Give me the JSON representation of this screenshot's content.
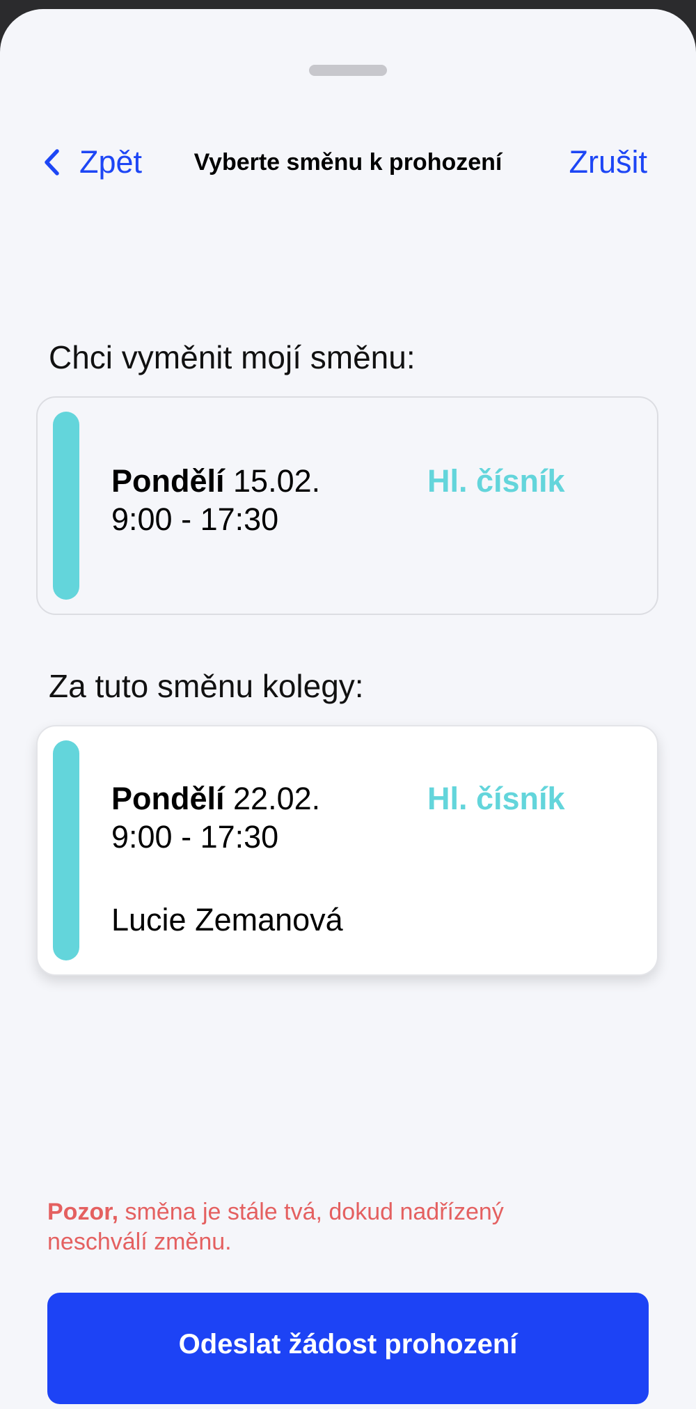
{
  "nav": {
    "back_label": "Zpět",
    "title": "Vyberte směnu k prohození",
    "cancel_label": "Zrušit"
  },
  "my_shift": {
    "section_label": "Chci vyměnit mojí směnu:",
    "day": "Pondělí",
    "date": "15.02.",
    "time": "9:00 - 17:30",
    "role": "Hl. čísník"
  },
  "colleague_shift": {
    "section_label": "Za tuto směnu kolegy:",
    "day": "Pondělí",
    "date": "22.02.",
    "time": "9:00 - 17:30",
    "role": "Hl. čísník",
    "person": "Lucie Zemanová"
  },
  "warning": {
    "bold": "Pozor,",
    "text": " směna je stále tvá, dokud nadřízený neschválí změnu."
  },
  "submit_label": "Odeslat žádost prohození",
  "colors": {
    "accent": "#1d46f5",
    "shift_bar": "#63d5db",
    "warning": "#e46060"
  },
  "icons": {
    "back": "chevron-left-icon"
  }
}
